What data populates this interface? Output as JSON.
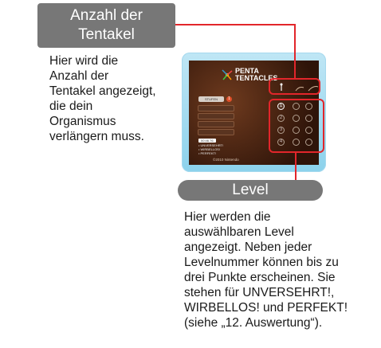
{
  "labels": {
    "tentacles": [
      "Anzahl der",
      "Tentakel"
    ],
    "level": "Level"
  },
  "descriptions": {
    "tentacles": [
      "Hier wird die",
      "Anzahl der",
      "Tentakel angezeigt,",
      "die dein",
      "Organismus",
      "verlängern muss."
    ],
    "level": [
      "Hier werden die",
      "auswählbaren Level",
      "angezeigt. Neben jeder",
      "Levelnummer können bis zu",
      "drei Punkte erscheinen. Sie",
      "stehen für UNVERSEHRT!,",
      "WIRBELLOS! und PERFEKT!",
      "(siehe „12. Auswertung“)."
    ]
  },
  "game_screen": {
    "title_line1": "PENTA",
    "title_line2": "TENTACLES",
    "stage_label": "STUFEN",
    "stage_number": "1",
    "score_text": "00:46.76",
    "legend": [
      "• UNVERSEHRT!",
      "• WIRBELLOS!",
      "• PERFEKT!"
    ],
    "copyright": "©2010 Nintendo",
    "levels": [
      "1",
      "2",
      "3",
      "4"
    ]
  },
  "colors": {
    "accent_red": "#e2262b",
    "label_gray": "#777777",
    "device_blue": "#8cd2ec"
  }
}
